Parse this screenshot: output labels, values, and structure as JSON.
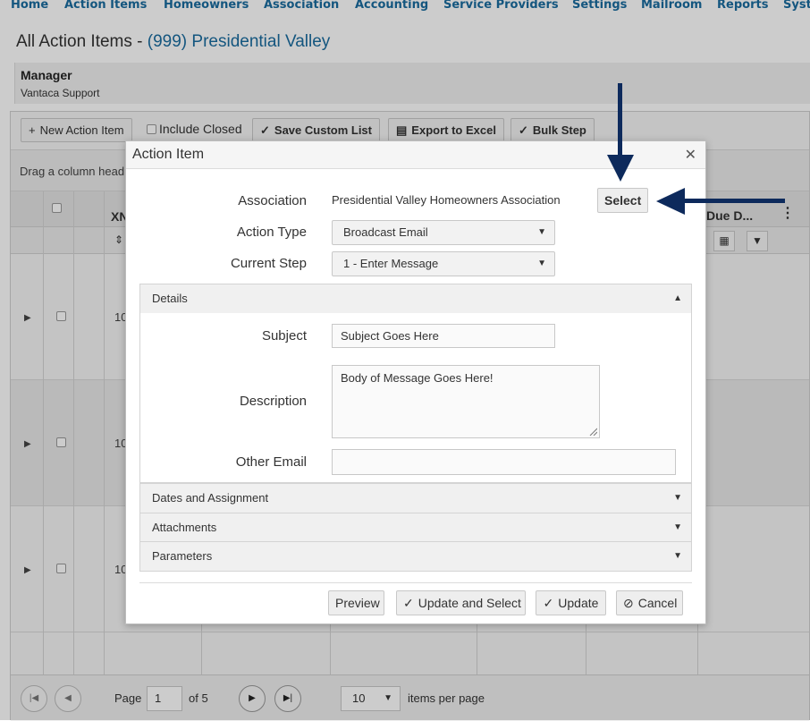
{
  "nav": {
    "items": [
      "Home",
      "Action Items",
      "Homeowners",
      "Association",
      "Accounting",
      "Service Providers",
      "Settings",
      "Mailroom",
      "Reports",
      "Syst"
    ]
  },
  "page": {
    "title_prefix": "All Action Items - ",
    "title_association": "(999) Presidential Valley",
    "manager_label": "Manager",
    "manager_value": "Vantaca Support"
  },
  "toolbar": {
    "new_action_item": "New Action Item",
    "include_closed": "Include Closed",
    "save_custom_list": "Save Custom List",
    "export_to_excel": "Export to Excel",
    "bulk_step": "Bulk Step"
  },
  "grid": {
    "group_hint": "Drag a column head",
    "col_xn": "XN",
    "col_due_date": "Due D...",
    "row_values": [
      "10",
      "10",
      "10"
    ]
  },
  "pager": {
    "page_label": "Page",
    "page_value": "1",
    "of_label": "of 5",
    "page_size": "10",
    "items_per_page": "items per page"
  },
  "modal": {
    "title": "Action Item",
    "association_label": "Association",
    "association_value": "Presidential Valley Homeowners Association",
    "select_button": "Select",
    "action_type_label": "Action Type",
    "action_type_value": "Broadcast Email",
    "current_step_label": "Current Step",
    "current_step_value": "1 - Enter Message",
    "details_header": "Details",
    "subject_label": "Subject",
    "subject_value": "Subject Goes Here",
    "description_label": "Description",
    "description_value": "Body of Message Goes Here!",
    "other_email_label": "Other Email",
    "other_email_value": "",
    "dates_header": "Dates and Assignment",
    "attachments_header": "Attachments",
    "parameters_header": "Parameters",
    "preview_button": "Preview",
    "update_select_button": "Update and Select",
    "update_button": "Update",
    "cancel_button": "Cancel"
  },
  "colors": {
    "accent": "#1a6c9f",
    "arrow": "#0d2a5c"
  }
}
